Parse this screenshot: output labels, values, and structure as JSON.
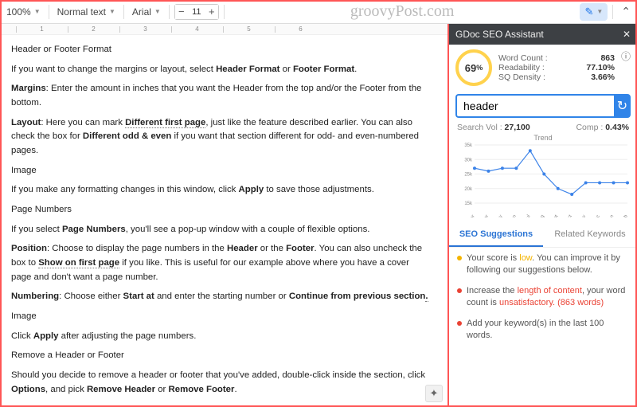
{
  "toolbar": {
    "zoom": "100%",
    "style": "Normal text",
    "font": "Arial",
    "fontsize": "11",
    "logo": "groovyPost.com"
  },
  "ruler": [
    "1",
    "2",
    "3",
    "4",
    "5",
    "6"
  ],
  "doc": {
    "h1": "Header or Footer Format",
    "p1a": "If you want to change the margins or layout, select ",
    "p1b": "Header Format",
    "p1c": " or ",
    "p1d": "Footer Format",
    "p1e": ".",
    "p2a": "Margins",
    "p2b": ": Enter the amount in inches that you want the Header from the top and/or the Footer from the bottom.",
    "p3a": "Layout",
    "p3b": ": Here you can mark ",
    "p3c": "Different first page",
    "p3d": ", just like the feature described earlier. You can also check the box for ",
    "p3e": "Different odd & even",
    "p3f": " if you want that section different for odd- and even-numbered pages.",
    "p4": "Image",
    "p5a": "If you make any formatting changes in this window, click ",
    "p5b": "Apply",
    "p5c": " to save those adjustments.",
    "p6": "Page Numbers",
    "p7a": "If you select ",
    "p7b": "Page Numbers",
    "p7c": ", you'll see a pop-up window with a couple of flexible options.",
    "p8a": "Position",
    "p8b": ": Choose to display the page numbers in the ",
    "p8c": "Header",
    "p8d": " or the ",
    "p8e": "Footer",
    "p8f": ". You can also uncheck the box to ",
    "p8g": "Show on first page",
    "p8h": " if you like. This is useful for our example above where you have a cover page and don't want a page number.",
    "p9a": "Numbering",
    "p9b": ": Choose either ",
    "p9c": "Start at",
    "p9d": " and enter the starting number or ",
    "p9e": "Continue from previous section",
    "p9f": ".",
    "p10": "Image",
    "p11a": "Click ",
    "p11b": "Apply",
    "p11c": " after adjusting the page numbers.",
    "p12": "Remove a Header or Footer",
    "p13a": "Should you decide to remove a header or footer that you've added, double-click inside the section, click ",
    "p13b": "Options",
    "p13c": ", and pick ",
    "p13d": "Remove Header",
    "p13e": " or ",
    "p13f": "Remove Footer",
    "p13g": "."
  },
  "sidebar": {
    "title": "GDoc SEO Assistant",
    "score": "69",
    "pct": "%",
    "stats": {
      "wc_label": "Word Count :",
      "wc": "863",
      "rd_label": "Readability :",
      "rd": "77.10%",
      "sq_label": "SQ Density :",
      "sq": "3.66%"
    },
    "keyword": "header",
    "sv_label": "Search Vol :",
    "sv": "27,100",
    "cp_label": "Comp :",
    "cp": "0.43%",
    "trend": "Trend",
    "tabs": {
      "seo": "SEO Suggestions",
      "rk": "Related Keywords"
    },
    "sug1a": "Your score is ",
    "sug1b": "low",
    "sug1c": ". You can improve it by following our suggestions below.",
    "sug2a": "Increase the ",
    "sug2b": "length of content",
    "sug2c": ", your word count is ",
    "sug2d": "unsatisfactory. (863 words)",
    "sug3": "Add your keyword(s) in the last 100 words."
  },
  "chart_data": {
    "type": "line",
    "title": "Trend",
    "ylabel": "",
    "xlabel": "",
    "ylim": [
      15000,
      35000
    ],
    "yticks": [
      "35k",
      "30k",
      "25k",
      "20k",
      "15k"
    ],
    "categories": [
      "Mar",
      "Apr",
      "May",
      "Jun",
      "Jul",
      "Aug",
      "Sept",
      "Oct",
      "Nov",
      "Dec",
      "Jan",
      "Feb"
    ],
    "values": [
      27000,
      26000,
      27000,
      27000,
      33000,
      25000,
      20000,
      18000,
      22000,
      22000,
      22000,
      22000
    ]
  }
}
